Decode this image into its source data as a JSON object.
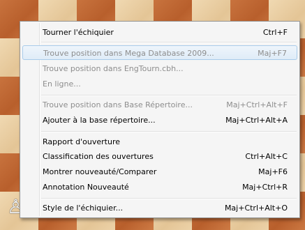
{
  "menu": {
    "items": [
      {
        "label": "Tourner l'échiquier",
        "shortcut": "Ctrl+F",
        "enabled": true
      },
      {
        "label": "Trouve position dans Mega Database 2009...",
        "shortcut": "Maj+F7",
        "enabled": false,
        "highlighted": true
      },
      {
        "label": "Trouve position dans EngTourn.cbh...",
        "shortcut": "",
        "enabled": false
      },
      {
        "label": "En ligne...",
        "shortcut": "",
        "enabled": false
      },
      {
        "label": "Trouve position dans Base Répertoire...",
        "shortcut": "Maj+Ctrl+Alt+F",
        "enabled": false
      },
      {
        "label": "Ajouter à la base répertoire...",
        "shortcut": "Maj+Ctrl+Alt+A",
        "enabled": true
      },
      {
        "label": "Rapport d'ouverture",
        "shortcut": "",
        "enabled": true
      },
      {
        "label": "Classification des ouvertures",
        "shortcut": "Ctrl+Alt+C",
        "enabled": true
      },
      {
        "label": "Montrer nouveauté/Comparer",
        "shortcut": "Maj+F6",
        "enabled": true
      },
      {
        "label": "Annotation Nouveauté",
        "shortcut": "Maj+Ctrl+R",
        "enabled": true
      },
      {
        "label": "Style de l'échiquier...",
        "shortcut": "Maj+Ctrl+Alt+O",
        "enabled": true
      }
    ]
  },
  "board": {
    "light_color": "#e9cc9f",
    "dark_color": "#c46a35",
    "piece": "white-pawn-icon"
  }
}
